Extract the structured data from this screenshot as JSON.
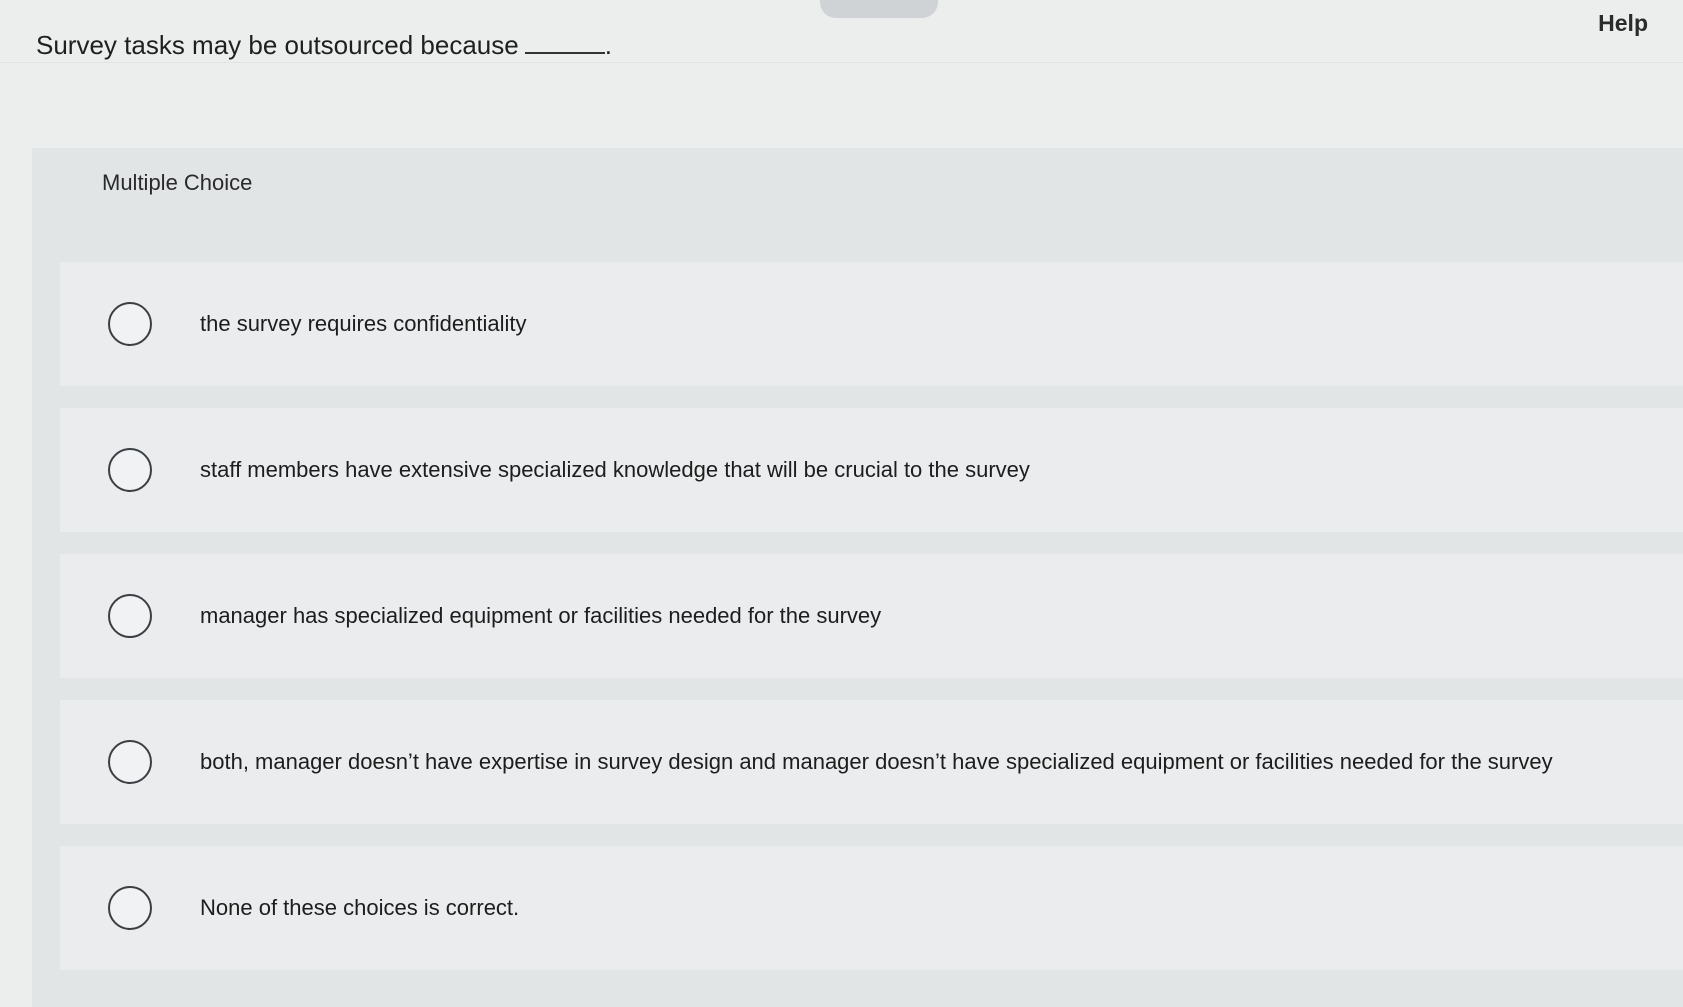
{
  "question": {
    "text": "Survey tasks may be outsourced because",
    "blank_suffix": "."
  },
  "header": {
    "help_label": "Help"
  },
  "panel": {
    "label": "Multiple Choice"
  },
  "options": [
    {
      "label": "the survey requires confidentiality"
    },
    {
      "label": "staff members have extensive specialized knowledge that will be crucial to the survey"
    },
    {
      "label": "manager has specialized equipment or facilities needed for the survey"
    },
    {
      "label": "both, manager doesn’t have expertise in survey design and manager doesn’t have specialized equipment or facilities needed for the survey"
    },
    {
      "label": "None of these choices is correct."
    }
  ]
}
